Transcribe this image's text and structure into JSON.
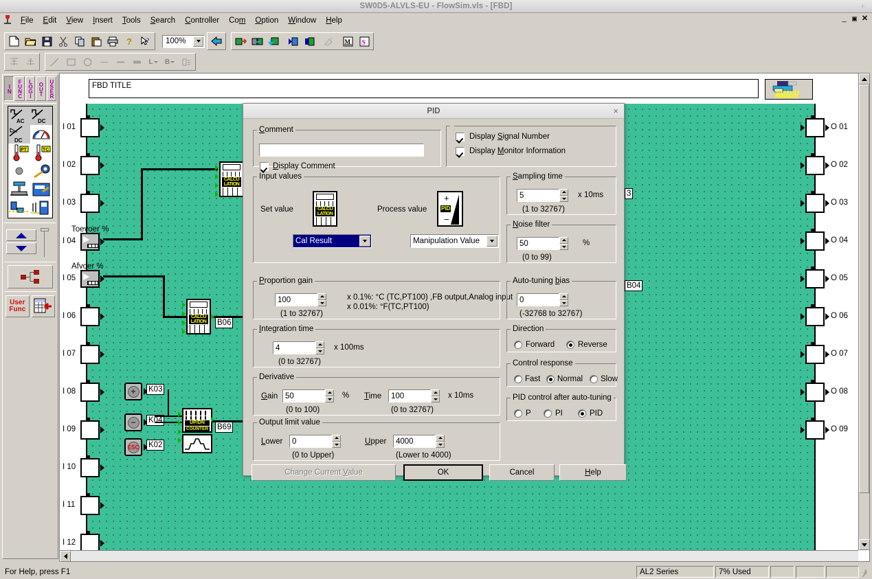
{
  "window": {
    "title": "SW0D5-ALVLS-EU - FlowSim.vls - [FBD]",
    "minimize": "_",
    "restore": "☐",
    "close": "×"
  },
  "menubar": {
    "app_icon": "wine-glass-icon",
    "items": [
      {
        "label": "File",
        "accel": "F"
      },
      {
        "label": "Edit",
        "accel": "E"
      },
      {
        "label": "View",
        "accel": "V"
      },
      {
        "label": "Insert",
        "accel": "I"
      },
      {
        "label": "Tools",
        "accel": "T"
      },
      {
        "label": "Search",
        "accel": "S"
      },
      {
        "label": "Controller",
        "accel": "C"
      },
      {
        "label": "Com",
        "accel": "m"
      },
      {
        "label": "Option",
        "accel": "O"
      },
      {
        "label": "Window",
        "accel": "W"
      },
      {
        "label": "Help",
        "accel": "H"
      }
    ]
  },
  "toolbar": {
    "zoom_value": "100%",
    "buttons_group1": [
      "new-document-icon",
      "open-folder-icon",
      "save-disk-icon",
      "cut-scissors-icon",
      "copy-icon",
      "paste-icon",
      "print-icon",
      "help-question-icon",
      "context-help-arrow-icon"
    ],
    "buttons_group2": [
      "back-arrow-icon"
    ],
    "buttons_group3": [
      "download-to-plc-icon",
      "verify-compare-icon",
      "upload-from-plc-icon",
      "run-monitor-icon",
      "stop-monitor-icon",
      "clear-icon",
      "memory-cassette-icon",
      "simulation-icon"
    ],
    "buttons_row2": [
      "align-bottom-icon",
      "align-center-icon",
      "line-tool-icon",
      "rectangle-tool-icon",
      "ellipse-tool-icon",
      "thin-line-icon",
      "medium-line-icon",
      "thick-line-icon",
      "line-style-icon",
      "bold-text-icon",
      "label-list-icon"
    ]
  },
  "palette": {
    "tabs": [
      {
        "label": "IN",
        "selected": true
      },
      {
        "label": "FUNC",
        "selected": false
      },
      {
        "label": "LOGI",
        "selected": false
      },
      {
        "label": "OUT",
        "selected": false
      },
      {
        "label": "USER",
        "selected": false
      }
    ],
    "icons": [
      "ac-input-icon",
      "dc-input-icon",
      "analog-dc-icon",
      "gauge-meter-icon",
      "pt100-sensor-icon",
      "thermocouple-icon",
      "pushbutton-icon",
      "key-switch-icon",
      "slide-switch-icon",
      "toggle-panel-icon",
      "bit-device-icon",
      "network-device-icon"
    ],
    "nav": {
      "up": "scroll-up-arrow",
      "down": "scroll-down-arrow"
    },
    "tree_button": "block-tree-icon",
    "user_func_label_line1": "User",
    "user_func_label_line2": "Func",
    "user_table_button": "user-table-icon"
  },
  "document": {
    "fbd_title": "FBD TITLE",
    "display_manager": {
      "line1": "DISPLAY",
      "line2": "MANAGER"
    },
    "inputs": [
      {
        "id": "I 01",
        "name": ""
      },
      {
        "id": "I 02",
        "name": ""
      },
      {
        "id": "I 03",
        "name": ""
      },
      {
        "id": "I 04",
        "name": "Toevoer %"
      },
      {
        "id": "I 05",
        "name": "Afvoer %"
      },
      {
        "id": "I 06",
        "name": ""
      },
      {
        "id": "I 07",
        "name": ""
      },
      {
        "id": "I 08",
        "name": ""
      },
      {
        "id": "I 09",
        "name": ""
      },
      {
        "id": "I 10",
        "name": ""
      },
      {
        "id": "I 11",
        "name": ""
      },
      {
        "id": "I 12",
        "name": ""
      }
    ],
    "outputs": [
      "O 01",
      "O 02",
      "O 03",
      "O 04",
      "O 05",
      "O 06",
      "O 07",
      "O 08",
      "O 09"
    ],
    "blocks": [
      {
        "tag": "",
        "type": "calculation",
        "label_line1": "CALCU",
        "label_line2": "LATION"
      },
      {
        "tag": "B06",
        "type": "calculation",
        "label_line1": "CALCU",
        "label_line2": "LATION"
      },
      {
        "tag": "B69",
        "type": "up-down-counter",
        "label_line1": "UP/DN",
        "label_line2": "COUNTER"
      },
      {
        "tag": "B04",
        "type": "signal-tag"
      },
      {
        "tag": "3",
        "type": "signal-tag"
      }
    ],
    "key_tags": [
      "K03",
      "K04",
      "K02"
    ],
    "signal_tags": [
      "3",
      "B04",
      "B06",
      "B69"
    ]
  },
  "dialog": {
    "title": "PID",
    "close": "×",
    "comment": {
      "legend": "Comment",
      "legend_accel": "C",
      "value": "",
      "checkbox_label": "Display Comment",
      "checkbox_accel": "D",
      "checked": true
    },
    "display_options": [
      {
        "label": "Display Signal Number",
        "accel": "S",
        "checked": true
      },
      {
        "label": "Display Monitor Information",
        "accel": "M",
        "checked": true
      }
    ],
    "input_values": {
      "legend": "Input values",
      "set_value_label": "Set value",
      "set_value_icon": "calculation-block-icon",
      "set_value_selected": "Cal Result",
      "process_value_label": "Process value",
      "process_value_icon": "pid-block-icon",
      "process_value_selected": "Manipulation Value"
    },
    "proportion_gain": {
      "legend": "Proportion gain",
      "legend_accel": "P",
      "value": "100",
      "range": "(1 to 32767)",
      "note_line1": "x 0.1%: °C (TC,PT100) ,FB output,Analog input",
      "note_line2": "x 0.01%: °F(TC,PT100)"
    },
    "integration_time": {
      "legend": "Integration time",
      "legend_accel": "I",
      "value": "4",
      "unit": "x  100ms",
      "range": "(0 to 32767)"
    },
    "derivative": {
      "legend": "Derivative",
      "gain_label": "Gain",
      "gain_accel": "G",
      "gain_value": "50",
      "gain_unit": "%",
      "gain_range": "(0 to 100)",
      "time_label": "Time",
      "time_accel": "T",
      "time_value": "100",
      "time_unit": "x  10ms",
      "time_range": "(0 to 32767)"
    },
    "output_limit": {
      "legend": "Output limit value",
      "lower_label": "Lower",
      "lower_accel": "L",
      "lower_value": "0",
      "lower_range": "(0 to Upper)",
      "upper_label": "Upper",
      "upper_accel": "U",
      "upper_value": "4000",
      "upper_range": "(Lower to 4000)"
    },
    "sampling_time": {
      "legend": "Sampling time",
      "legend_accel": "S",
      "value": "5",
      "unit": "x 10ms",
      "range": "(1 to 32767)"
    },
    "noise_filter": {
      "legend": "Noise filter",
      "legend_accel": "N",
      "value": "50",
      "unit": "%",
      "range": "(0 to 99)"
    },
    "auto_tuning_bias": {
      "legend": "Auto-tuning bias",
      "legend_accel": "b",
      "value": "0",
      "range": "(-32768 to 32767)"
    },
    "direction": {
      "legend": "Direction",
      "options": [
        {
          "label": "Forward",
          "selected": false
        },
        {
          "label": "Reverse",
          "selected": true
        }
      ]
    },
    "control_response": {
      "legend": "Control response",
      "options": [
        {
          "label": "Fast",
          "selected": false
        },
        {
          "label": "Normal",
          "selected": true
        },
        {
          "label": "Slow",
          "selected": false
        }
      ]
    },
    "pid_after_autotuning": {
      "legend": "PID control after auto-tuning",
      "options": [
        {
          "label": "P",
          "selected": false
        },
        {
          "label": "PI",
          "selected": false
        },
        {
          "label": "PID",
          "selected": true
        }
      ]
    },
    "buttons": [
      {
        "label": "Change Current Value",
        "accel": "V",
        "disabled": true,
        "default": false
      },
      {
        "label": "OK",
        "accel": "O",
        "disabled": false,
        "default": true
      },
      {
        "label": "Cancel",
        "accel": "",
        "disabled": false,
        "default": false
      },
      {
        "label": "Help",
        "accel": "H",
        "disabled": false,
        "default": false
      }
    ]
  },
  "statusbar": {
    "hint": "For Help, press F1",
    "series": "AL2 Series",
    "memory": "7% Used",
    "panel4": "",
    "panel5": "",
    "panel6": ""
  },
  "colors": {
    "canvas": "#3dbf97",
    "chrome": "#d4d0c8",
    "selection": "#000080",
    "accent_yellow": "#ffff00",
    "palette_text": "#a000a0"
  }
}
